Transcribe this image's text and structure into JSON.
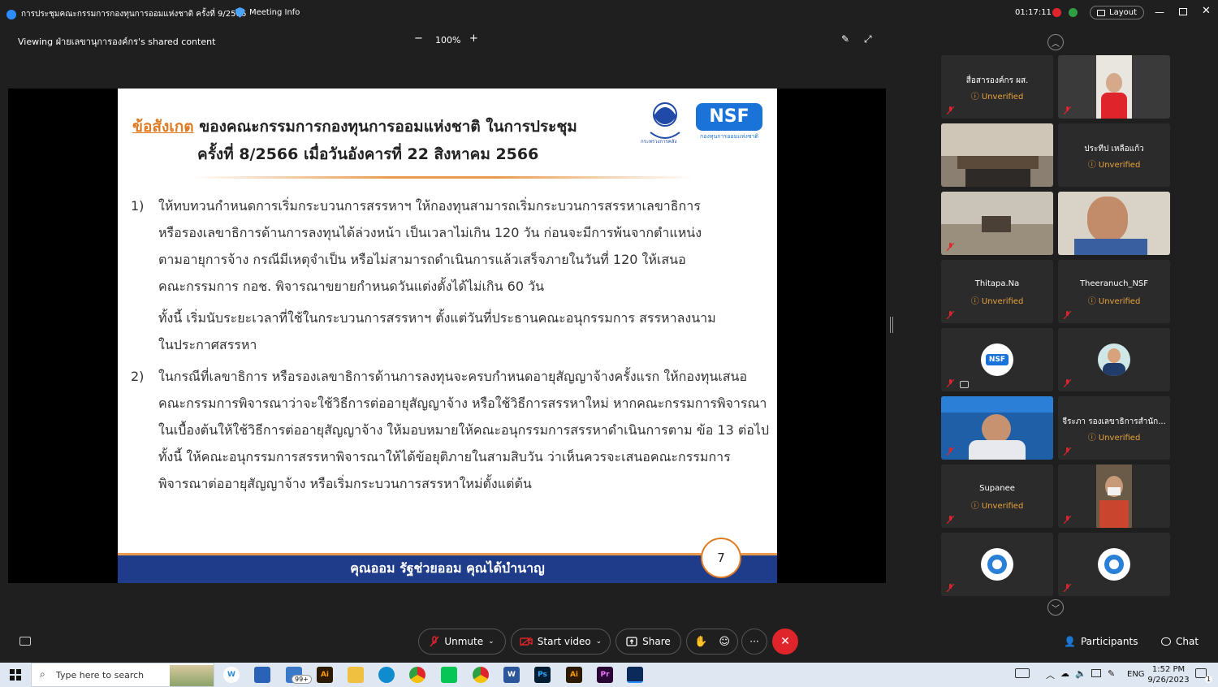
{
  "titlebar": {
    "meeting_title": "การประชุมคณะกรรมการกองทุนการออมแห่งชาติ ครั้งที่ 9/2566",
    "meeting_info": "Meeting Info",
    "timer": "01:17:11",
    "layout": "Layout"
  },
  "viewbar": {
    "viewing": "Viewing ฝ่ายเลขานุการองค์กร's shared content",
    "zoom": "100%",
    "zoom_out": "−",
    "zoom_in": "+"
  },
  "slide": {
    "title_note": "ข้อสังเกต",
    "title_rest": " ของคณะกรรมการกองทุนการออมแห่งชาติ ในการประชุม",
    "title_line2": "ครั้งที่ 8/2566 เมื่อวันอังคารที่ 22 สิงหาคม 2566",
    "logo_text": "NSF",
    "logo_caption": "กองทุนการออมแห่งชาติ",
    "emblem_caption": "กระทรวงการคลัง",
    "p1_num": "1)",
    "p1_l1": "ให้ทบทวนกำหนดการเริ่มกระบวนการสรรหาฯ ให้กองทุนสามารถเริ่มกระบวนการสรรหาเลขาธิการ",
    "p1_l2": "หรือรองเลขาธิการด้านการลงทุนได้ล่วงหน้า เป็นเวลาไม่เกิน 120 วัน ก่อนจะมีการพ้นจากตำแหน่ง",
    "p1_l3": "ตามอายุการจ้าง กรณีมีเหตุจำเป็น หรือไม่สามารถดำเนินการแล้วเสร็จภายในวันที่ 120 ให้เสนอ",
    "p1_l4": "คณะกรรมการ กอช. พิจารณาขยายกำหนดวันแต่งตั้งได้ไม่เกิน 60 วัน",
    "p1_l5": "ทั้งนี้ เริ่มนับระยะเวลาที่ใช้ในกระบวนการสรรหาฯ ตั้งแต่วันที่ประธานคณะอนุกรรมการ สรรหาลงนาม",
    "p1_l6": "ในประกาศสรรหา",
    "p2_num": "2)",
    "p2_l1": "ในกรณีที่เลขาธิการ หรือรองเลขาธิการด้านการลงทุนจะครบกำหนดอายุสัญญาจ้างครั้งแรก ให้กองทุนเสนอ",
    "p2_l2": "คณะกรรมการพิจารณาว่าจะใช้วิธีการต่ออายุสัญญาจ้าง หรือใช้วิธีการสรรหาใหม่ หากคณะกรรมการพิจารณา",
    "p2_l3": "ในเบื้องต้นให้ใช้วิธีการต่ออายุสัญญาจ้าง ให้มอบหมายให้คณะอนุกรรมการสรรหาดำเนินการตาม ข้อ 13 ต่อไป",
    "p2_l4": "ทั้งนี้ ให้คณะอนุกรรมการสรรหาพิจารณาให้ได้ข้อยุติภายในสามสิบวัน ว่าเห็นควรจะเสนอคณะกรรมการ",
    "p2_l5": "พิจารณาต่ออายุสัญญาจ้าง หรือเริ่มกระบวนการสรรหาใหม่ตั้งแต่ต้น",
    "footer": "คุณออม รัฐช่วยออม คุณได้บำนาญ",
    "page": "7"
  },
  "participants": {
    "unverified": "Unverified",
    "tiles": [
      {
        "name": "สื่อสารองค์กร ผส."
      },
      {
        "name": ""
      },
      {
        "name": ""
      },
      {
        "name": "ประทีป เหลือแก้ว"
      },
      {
        "name": ""
      },
      {
        "name": ""
      },
      {
        "name": "Thitapa.Na"
      },
      {
        "name": "Theeranuch_NSF"
      },
      {
        "name": "NSF"
      },
      {
        "name": ""
      },
      {
        "name": ""
      },
      {
        "name": "จีระภา รองเลขาธิการสำนัก..."
      },
      {
        "name": "Supanee"
      },
      {
        "name": ""
      },
      {
        "name": ""
      },
      {
        "name": ""
      }
    ]
  },
  "controls": {
    "unmute": "Unmute",
    "start_video": "Start video",
    "share": "Share",
    "more": "···",
    "participants": "Participants",
    "chat": "Chat"
  },
  "taskbar": {
    "search_placeholder": "Type here to search",
    "badge": "99+",
    "lang": "ENG",
    "time": "1:52 PM",
    "date": "9/26/2023",
    "notif": "1",
    "apps": [
      "W",
      "",
      "",
      "Ai",
      "",
      "",
      "",
      "",
      "",
      "W",
      "Ps",
      "Ai",
      "Pr",
      ""
    ]
  },
  "colors": {
    "accent_red": "#e0242b",
    "unverified": "#e8a33d",
    "slide_footer": "#1f3c8a",
    "slide_orange": "#e07b24"
  }
}
